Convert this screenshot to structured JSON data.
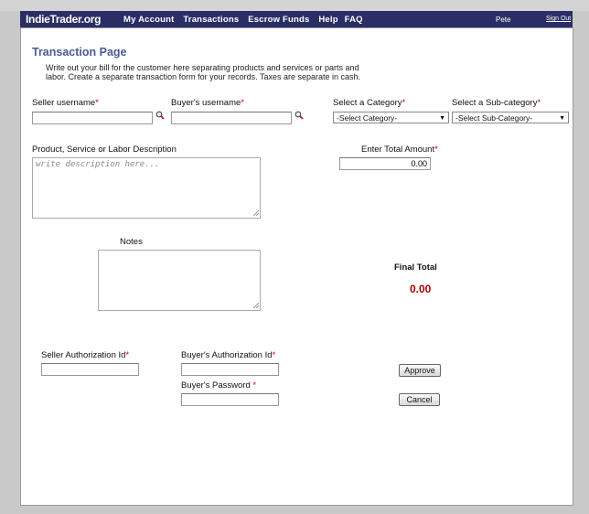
{
  "nav": {
    "brand": "IndieTrader.org",
    "links": [
      "My Account",
      "Transactions",
      "Escrow Funds",
      "Help",
      "FAQ"
    ],
    "user": "Pete",
    "signout": "Sign Out"
  },
  "page": {
    "title": "Transaction Page",
    "intro": "Write out your bill for the customer here separating products and services or parts and labor.  Create a separate transaction form for your records. Taxes are separate in cash."
  },
  "form": {
    "seller_username_label": "Seller username",
    "buyer_username_label": "Buyer's username",
    "category_label": "Select a Category",
    "category_value": "-Select Category-",
    "subcategory_label": "Select a Sub-category",
    "subcategory_value": "-Select Sub-Category-",
    "description_label": "Product, Service or Labor Description",
    "description_placeholder": "write description here...",
    "amount_label": "Enter Total Amount",
    "amount_value": "0.00",
    "notes_label": "Notes",
    "final_total_label": "Final Total",
    "final_total_value": "0.00",
    "seller_auth_label": "Seller Authorization Id",
    "buyer_auth_label": "Buyer's Authorization Id",
    "buyer_password_label": "Buyer's Password",
    "required_marker": "*",
    "approve_label": "Approve",
    "cancel_label": "Cancel"
  },
  "icons": {
    "lookup": "magnifier-icon",
    "dropdown": "chevron-down-icon",
    "resize": "resize-grip-icon"
  },
  "colors": {
    "navbar": "#2b2e66",
    "title": "#4a5a94",
    "required": "#c40000",
    "final_total": "#aa0000"
  }
}
